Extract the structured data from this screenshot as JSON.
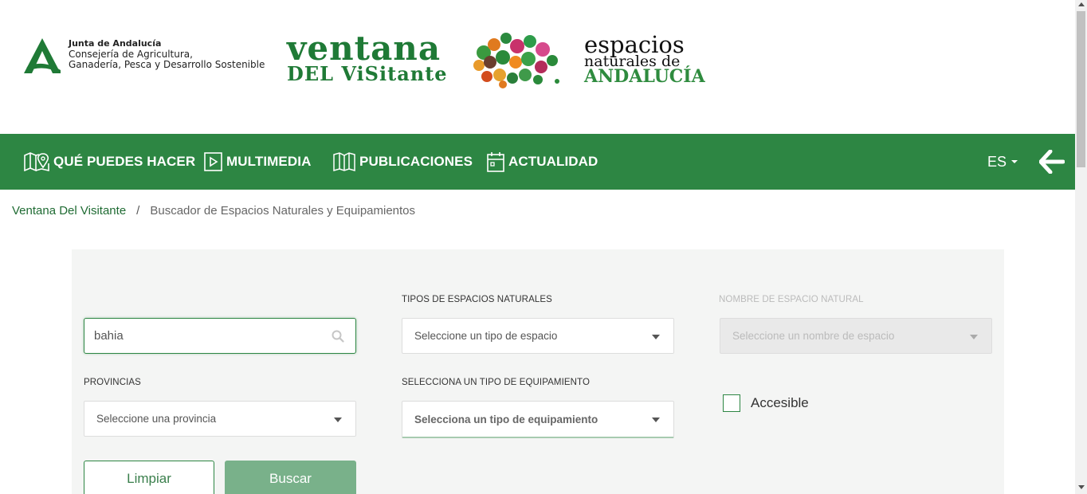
{
  "header": {
    "junta": {
      "name": "Junta de Andalucía",
      "dept_line1": "Consejería de Agricultura,",
      "dept_line2": "Ganadería, Pesca y Desarrollo Sostenible"
    },
    "ventana": {
      "line1": "ventana",
      "line2": "DEL ViSitante"
    },
    "espacios": {
      "line1": "espacios",
      "line2": "naturales de",
      "line3": "ANDALUCÍA"
    }
  },
  "nav": {
    "items": [
      {
        "label": "QUÉ PUEDES HACER",
        "icon": "map-pin-icon"
      },
      {
        "label": "MULTIMEDIA",
        "icon": "play-icon"
      },
      {
        "label": "PUBLICACIONES",
        "icon": "book-icon"
      },
      {
        "label": "ACTUALIDAD",
        "icon": "calendar-icon"
      }
    ],
    "language": "ES",
    "back_icon": "arrow-left-icon"
  },
  "breadcrumb": {
    "home": "Ventana Del Visitante",
    "separator": "/",
    "current": "Buscador de Espacios Naturales y Equipamientos"
  },
  "search": {
    "query_value": "bahia",
    "tipos_label": "TIPOS DE ESPACIOS NATURALES",
    "tipos_placeholder": "Seleccione un tipo de espacio",
    "nombre_label": "NOMBRE DE ESPACIO NATURAL",
    "nombre_placeholder": "Seleccione un nombre de espacio",
    "provincias_label": "PROVINCIAS",
    "provincias_placeholder": "Seleccione una provincia",
    "equipamiento_label": "SELECCIONA UN TIPO DE EQUIPAMIENTO",
    "equipamiento_placeholder": "Selecciona un tipo de equipamiento",
    "accesible_label": "Accesible",
    "clear_label": "Limpiar",
    "search_label": "Buscar"
  },
  "colors": {
    "brand_green": "#2d8643",
    "button_green": "#79b18a",
    "panel_bg": "#f4f5f4"
  }
}
